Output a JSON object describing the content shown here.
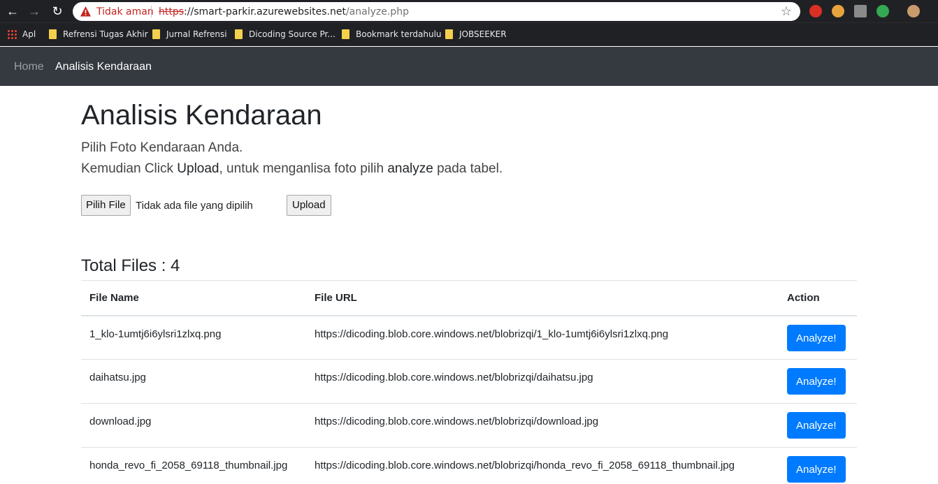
{
  "browser": {
    "security_label": "Tidak aman",
    "url_scheme": "https",
    "url_host": "://smart-parkir.azurewebsites.net",
    "url_path": "/analyze.php",
    "bookmarks": [
      {
        "label": "Apl",
        "icon": "apps-grid-icon"
      },
      {
        "label": "Refrensi Tugas Akhir",
        "icon": "folder-icon"
      },
      {
        "label": "Jurnal Refrensi",
        "icon": "folder-icon"
      },
      {
        "label": "Dicoding Source Pr...",
        "icon": "folder-icon"
      },
      {
        "label": "Bookmark terdahulu",
        "icon": "folder-icon"
      },
      {
        "label": "JOBSEEKER",
        "icon": "folder-icon"
      }
    ]
  },
  "navbar": {
    "home": "Home",
    "active": "Analisis Kendaraan"
  },
  "page": {
    "title": "Analisis Kendaraan",
    "lead1": "Pilih Foto Kendaraan Anda.",
    "lead2_a": "Kemudian Click ",
    "lead2_b": "Upload",
    "lead2_c": ", untuk menganlisa foto pilih ",
    "lead2_d": "analyze",
    "lead2_e": " pada tabel."
  },
  "upload": {
    "choose_label": "Pilih File",
    "status": "Tidak ada file yang dipilih",
    "upload_label": "Upload"
  },
  "files": {
    "total_label": "Total Files : 4",
    "columns": [
      "File Name",
      "File URL",
      "Action"
    ],
    "rows": [
      {
        "name": "1_klo-1umtj6i6ylsri1zlxq.png",
        "url": "https://dicoding.blob.core.windows.net/blobrizqi/1_klo-1umtj6i6ylsri1zlxq.png",
        "action": "Analyze!"
      },
      {
        "name": "daihatsu.jpg",
        "url": "https://dicoding.blob.core.windows.net/blobrizqi/daihatsu.jpg",
        "action": "Analyze!"
      },
      {
        "name": "download.jpg",
        "url": "https://dicoding.blob.core.windows.net/blobrizqi/download.jpg",
        "action": "Analyze!"
      },
      {
        "name": "honda_revo_fi_2058_69118_thumbnail.jpg",
        "url": "https://dicoding.blob.core.windows.net/blobrizqi/honda_revo_fi_2058_69118_thumbnail.jpg",
        "action": "Analyze!"
      }
    ]
  },
  "colors": {
    "navbar": "#343a40",
    "primary": "#007bff",
    "browser_chrome": "#202124"
  }
}
